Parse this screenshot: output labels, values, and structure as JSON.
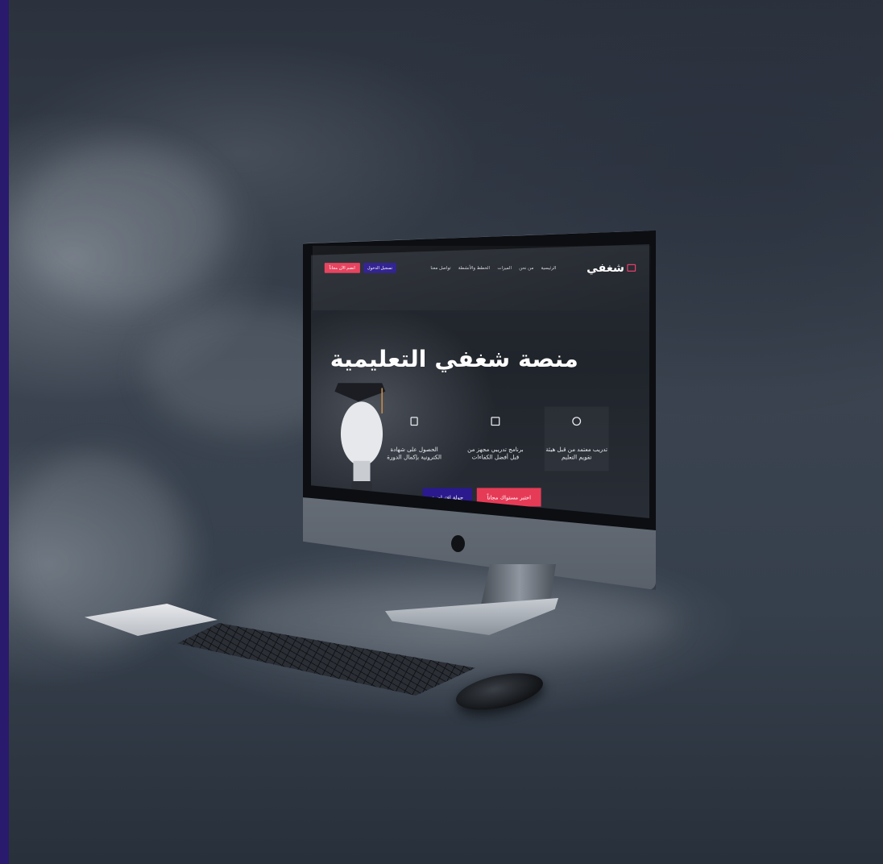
{
  "site": {
    "logo_text": "شغفي",
    "nav": [
      "الرئيسية",
      "من نحن",
      "الميزات",
      "الخطط والأنشطة",
      "تواصل معنا"
    ],
    "login_label": "تسجيل الدخول",
    "join_label": "انضم الآن مجاناً",
    "hero_title": "منصة شغفي التعليمية",
    "features": [
      {
        "icon": "medal-icon",
        "text": "تدريب معتمد من قبل هيئة تقويم التعليم"
      },
      {
        "icon": "book-icon",
        "text": "برنامج تدريبي مجهز من قبل أفضل الكفاءات"
      },
      {
        "icon": "certificate-icon",
        "text": "الحصول على شهادة الكترونية بإكمال الدورة"
      }
    ],
    "cta_primary": "اختبر مستواك مجاناً",
    "cta_secondary": "جولة افتراضية"
  },
  "colors": {
    "accent_red": "#e63b57",
    "accent_purple": "#2a1a8e",
    "frame_bar": "#2a1a6e"
  }
}
